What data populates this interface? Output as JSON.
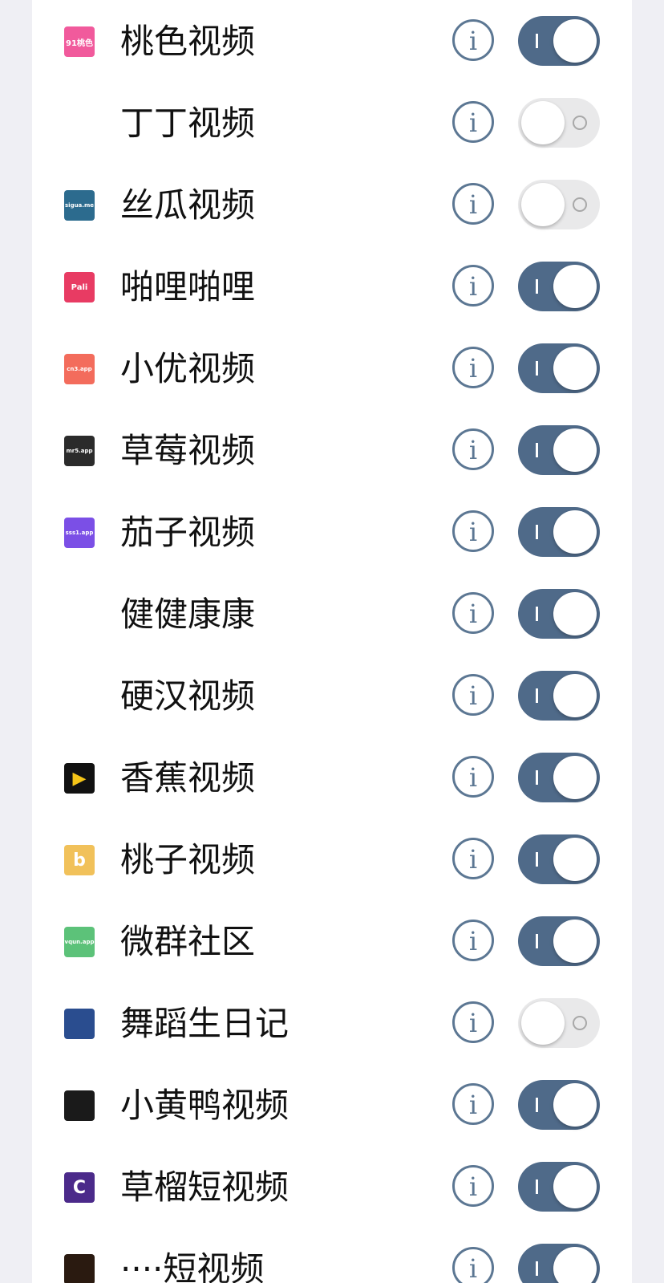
{
  "app_list": [
    {
      "name": "桃色视频",
      "enabled": true,
      "icon": "taose-icon",
      "icon_text": "91桃色",
      "icon_bg": "#f15a9c",
      "icon_fg": "#ffffff"
    },
    {
      "name": "丁丁视频",
      "enabled": false,
      "icon": "dingding-icon",
      "icon_text": "",
      "icon_bg": "#ffffff",
      "icon_fg": "#b07a55"
    },
    {
      "name": "丝瓜视频",
      "enabled": false,
      "icon": "sigua-icon",
      "icon_text": "sigua.me",
      "icon_bg": "#2c6b8e",
      "icon_fg": "#ffffff"
    },
    {
      "name": "啪哩啪哩",
      "enabled": true,
      "icon": "pali-icon",
      "icon_text": "Pali",
      "icon_bg": "#e83b63",
      "icon_fg": "#ffffff"
    },
    {
      "name": "小优视频",
      "enabled": true,
      "icon": "xiaoyou-icon",
      "icon_text": "cn3.app",
      "icon_bg": "#f36c5c",
      "icon_fg": "#ffffff"
    },
    {
      "name": "草莓视频",
      "enabled": true,
      "icon": "caomei-icon",
      "icon_text": "mr5.app",
      "icon_bg": "#2b2b2b",
      "icon_fg": "#ffffff"
    },
    {
      "name": "茄子视频",
      "enabled": true,
      "icon": "qiezi-icon",
      "icon_text": "sss1.app",
      "icon_bg": "#7b4fe6",
      "icon_fg": "#ffffff"
    },
    {
      "name": "健健康康",
      "enabled": true,
      "icon": "jianjian-icon",
      "icon_text": "",
      "icon_bg": "#ffffff",
      "icon_fg": "#b8502a"
    },
    {
      "name": "硬汉视频",
      "enabled": true,
      "icon": "yinghan-icon",
      "icon_text": "",
      "icon_bg": "#ffffff",
      "icon_fg": "#4aa3df"
    },
    {
      "name": "香蕉视频",
      "enabled": true,
      "icon": "xiangjiao-icon",
      "icon_text": "▶",
      "icon_bg": "#111111",
      "icon_fg": "#f5c518"
    },
    {
      "name": "桃子视频",
      "enabled": true,
      "icon": "taozi-icon",
      "icon_text": "b",
      "icon_bg": "#f1c15a",
      "icon_fg": "#ffffff"
    },
    {
      "name": "微群社区",
      "enabled": true,
      "icon": "weiqun-icon",
      "icon_text": "vqun.app",
      "icon_bg": "#5cc279",
      "icon_fg": "#ffffff"
    },
    {
      "name": "舞蹈生日记",
      "enabled": false,
      "icon": "wudao-icon",
      "icon_text": "",
      "icon_bg": "#2a4d8f",
      "icon_fg": "#ffffff"
    },
    {
      "name": "小黄鸭视频",
      "enabled": true,
      "icon": "xiaohuangya-icon",
      "icon_text": "",
      "icon_bg": "#1a1a1a",
      "icon_fg": "#f5d000"
    },
    {
      "name": "草榴短视频",
      "enabled": true,
      "icon": "caoliu-icon",
      "icon_text": "C",
      "icon_bg": "#4b2a8a",
      "icon_fg": "#ffffff"
    },
    {
      "name": "····短视频",
      "enabled": true,
      "icon": "partial-app-icon",
      "icon_text": "",
      "icon_bg": "#2a1a10",
      "icon_fg": "#ffffff"
    }
  ],
  "info_glyph": "i"
}
